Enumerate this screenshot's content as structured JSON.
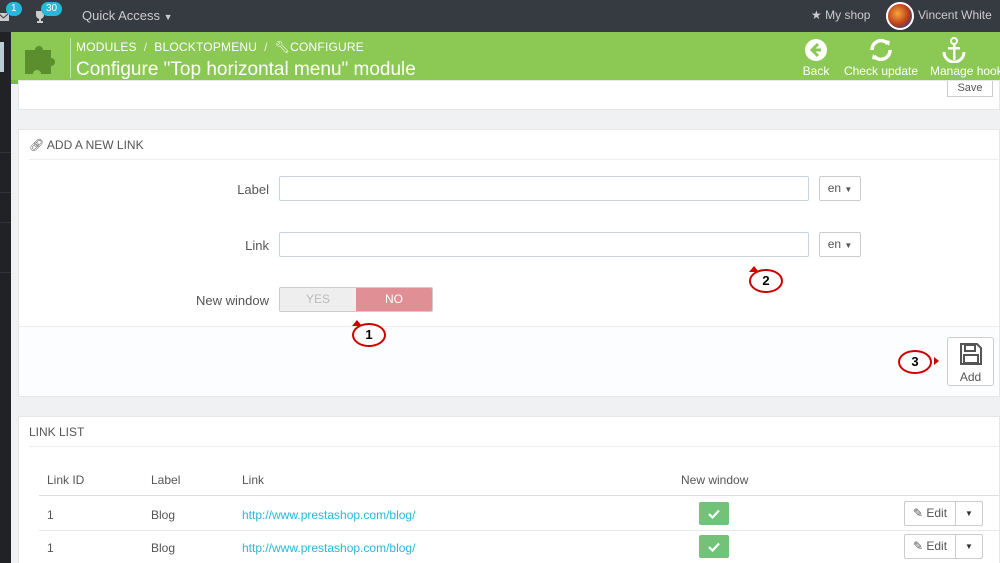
{
  "topbar": {
    "orders_badge": "1",
    "customers_badge": "30",
    "quick_access": "Quick Access",
    "my_shop": "My shop",
    "user_name": "Vincent White"
  },
  "header": {
    "breadcrumb": [
      "MODULES",
      "BLOCKTOPMENU",
      "CONFIGURE"
    ],
    "title": "Configure \"Top horizontal menu\" module",
    "buttons": {
      "back": "Back",
      "check_update": "Check update",
      "manage_hooks": "Manage hooks"
    }
  },
  "top_panel": {
    "save_label": "Save"
  },
  "add_link": {
    "heading": "ADD A NEW LINK",
    "label_field": {
      "label": "Label",
      "value": "",
      "lang": "en"
    },
    "link_field": {
      "label": "Link",
      "value": "",
      "lang": "en"
    },
    "new_window": {
      "label": "New window",
      "yes": "YES",
      "no": "NO",
      "selected": "NO"
    },
    "add_label": "Add"
  },
  "annotations": {
    "c1": "1",
    "c2": "2",
    "c3": "3"
  },
  "link_list": {
    "heading": "LINK LIST",
    "columns": [
      "Link ID",
      "Label",
      "Link",
      "New window"
    ],
    "rows": [
      {
        "id": "1",
        "label": "Blog",
        "link": "http://www.prestashop.com/blog/",
        "new_window": true,
        "action": "Edit"
      },
      {
        "id": "1",
        "label": "Blog",
        "link": "http://www.prestashop.com/blog/",
        "new_window": true,
        "action": "Edit"
      }
    ]
  },
  "colors": {
    "header_green": "#8bc954",
    "toggle_no": "#e08f95",
    "check_green": "#72c279",
    "link_blue": "#25b9d7",
    "badge_blue": "#25b9d7",
    "callout_red": "#cc0000"
  }
}
